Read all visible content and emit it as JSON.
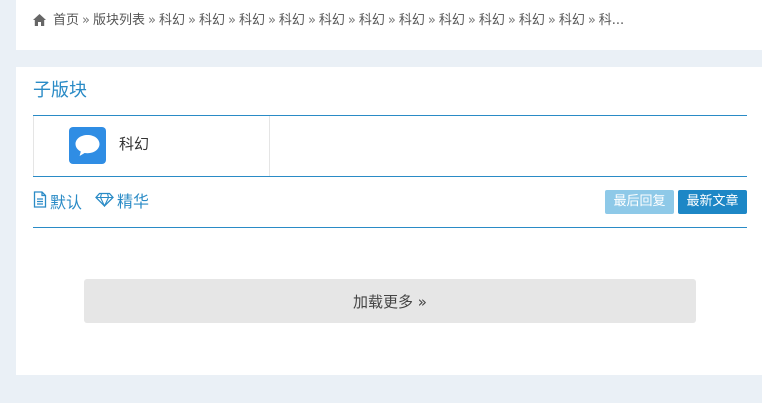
{
  "breadcrumb": {
    "home_icon": "home-icon",
    "items": [
      "首页",
      "版块列表",
      "科幻",
      "科幻",
      "科幻",
      "科幻",
      "科幻",
      "科幻",
      "科幻",
      "科幻",
      "科幻",
      "科幻",
      "科幻",
      "科..."
    ],
    "separator": "»"
  },
  "subforums": {
    "title": "子版块",
    "items": [
      {
        "name": "科幻",
        "icon": "chat-bubble-icon"
      }
    ]
  },
  "sort": {
    "default_label": "默认",
    "featured_label": "精华",
    "last_reply_label": "最后回复",
    "latest_label": "最新文章"
  },
  "load_more": {
    "label": "加载更多 »"
  },
  "colors": {
    "accent": "#2a8bc6",
    "icon_bg": "#2f8de4",
    "btn_active": "#1d87c6",
    "btn_inactive": "#8ec9e8"
  }
}
